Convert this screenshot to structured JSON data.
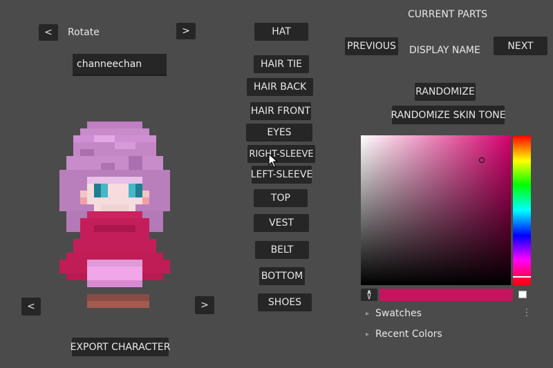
{
  "rotate": {
    "left": "<",
    "label": "Rotate",
    "right": ">"
  },
  "name_input": {
    "value": "channeechan"
  },
  "bottom_arrows": {
    "left": "<",
    "right": ">"
  },
  "export_button": "EXPORT CHARACTER",
  "parts": [
    "HAT",
    "HAIR TIE",
    "HAIR BACK",
    "HAIR FRONT",
    "EYES",
    "RIGHT-SLEEVE",
    "LEFT-SLEEVE",
    "TOP",
    "VEST",
    "BELT",
    "BOTTOM",
    "SHOES"
  ],
  "current": {
    "title": "CURRENT PARTS",
    "previous": "PREVIOUS",
    "display_name": "DISPLAY NAME",
    "next": "NEXT",
    "randomize": "RANDOMIZE",
    "randomize_skin": "RANDOMIZE SKIN TONE"
  },
  "color_picker": {
    "selected_color": "#c4155e",
    "hue_color": "#d6006d",
    "eyedropper_icon": "eyedropper-icon",
    "swatches": "Swatches",
    "recent_colors": "Recent Colors"
  }
}
